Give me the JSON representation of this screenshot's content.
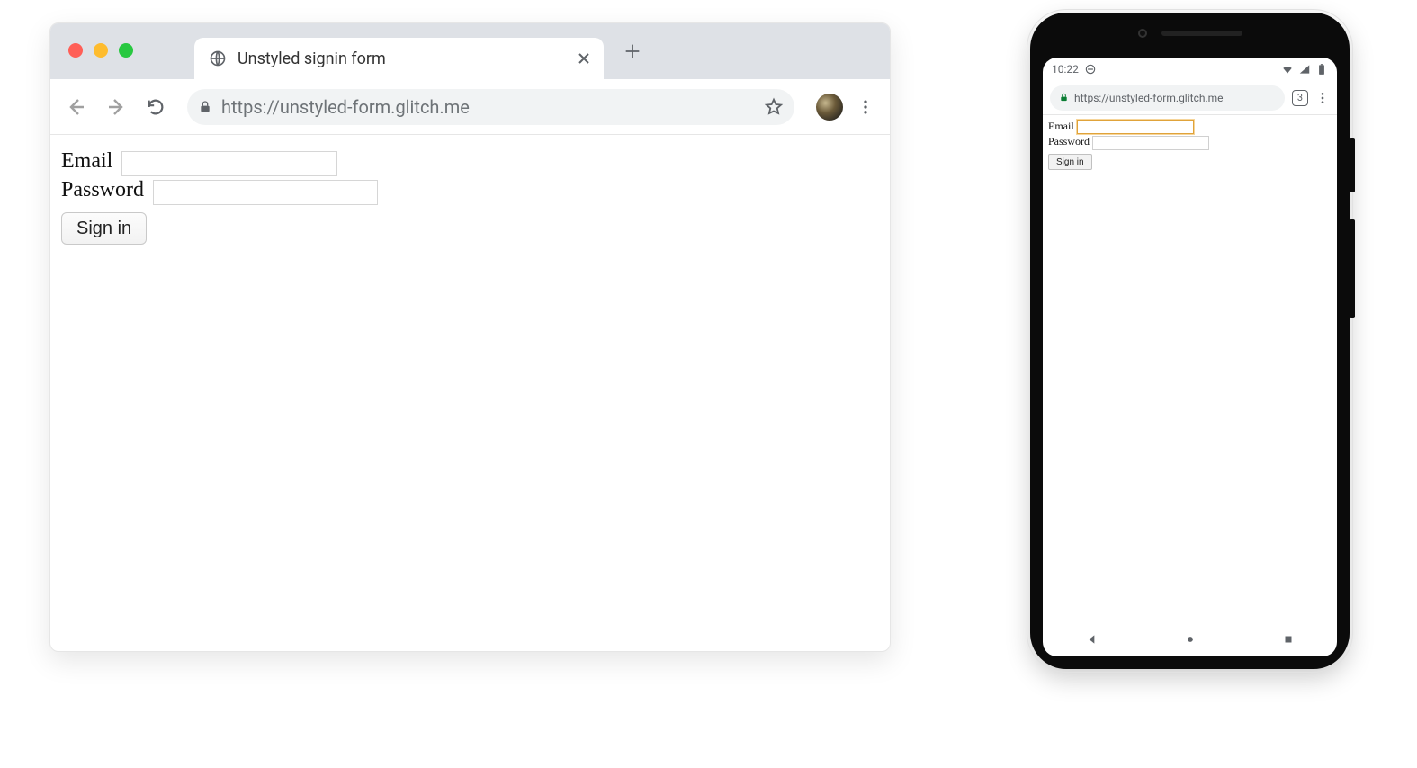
{
  "desktop": {
    "tab": {
      "title": "Unstyled signin form"
    },
    "url": "https://unstyled-form.glitch.me",
    "form": {
      "email_label": "Email",
      "password_label": "Password",
      "signin_label": "Sign in"
    }
  },
  "mobile": {
    "status": {
      "time": "10:22"
    },
    "url": "https://unstyled-form.glitch.me",
    "tab_count": "3",
    "form": {
      "email_label": "Email",
      "password_label": "Password",
      "signin_label": "Sign in"
    }
  }
}
